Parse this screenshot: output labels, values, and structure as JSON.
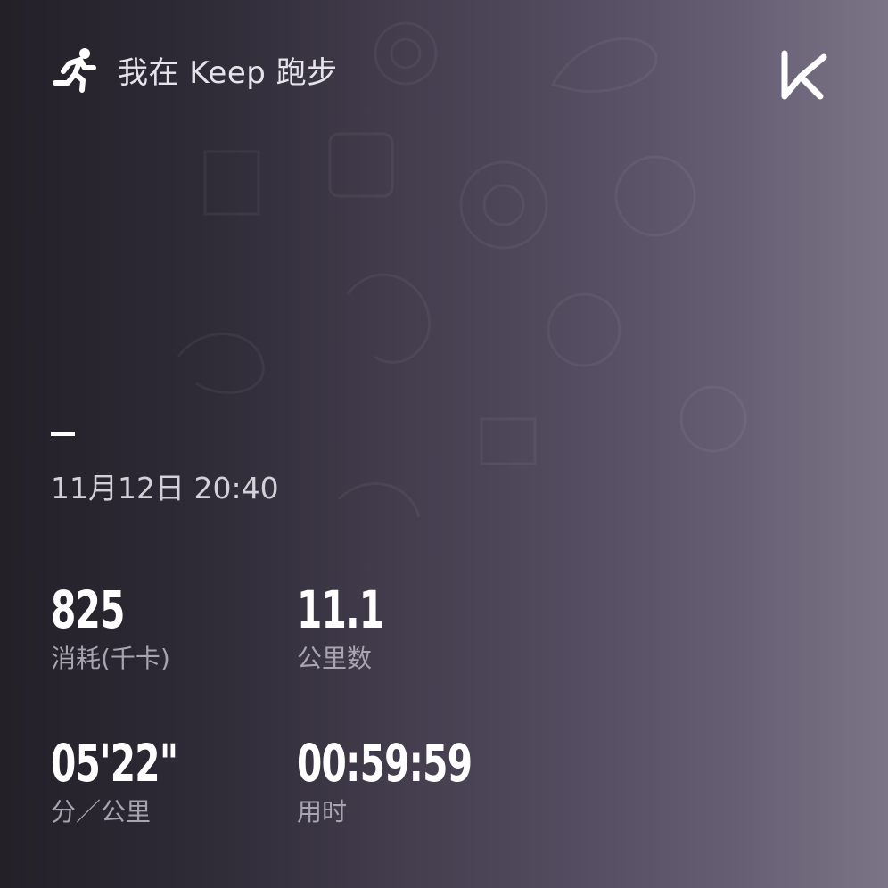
{
  "header": {
    "icon": "running-person-icon",
    "title": "我在 Keep 跑步"
  },
  "brand": {
    "icon": "keep-logo-icon",
    "name": "Keep"
  },
  "workout": {
    "datetime": "11月12日 20:40"
  },
  "stats": [
    {
      "value": "825",
      "label": "消耗(千卡)"
    },
    {
      "value": "11.1",
      "label": "公里数"
    },
    {
      "value": "05'22\"",
      "label": "分／公里"
    },
    {
      "value": "00:59:59",
      "label": "用时"
    }
  ],
  "colors": {
    "background_left": "#232028",
    "background_right": "#7b7486",
    "text_primary": "#ffffff",
    "text_secondary": "#a9a5b0"
  }
}
